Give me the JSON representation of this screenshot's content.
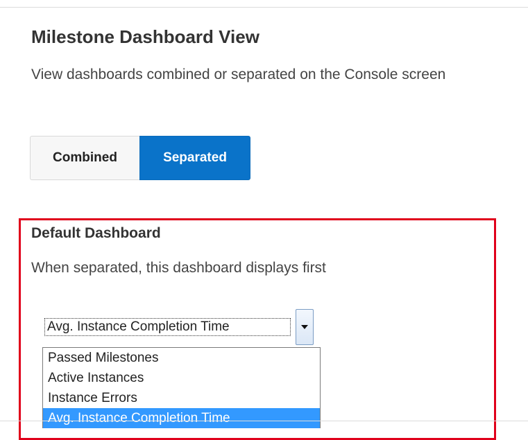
{
  "header": {
    "title": "Milestone Dashboard View",
    "description": "View dashboards combined or separated on the Console screen"
  },
  "view_toggle": {
    "options": [
      "Combined",
      "Separated"
    ],
    "selected": "Separated",
    "colors": {
      "active_bg": "#0a73c9",
      "inactive_bg": "#f7f7f7"
    }
  },
  "default_dashboard": {
    "title": "Default Dashboard",
    "description": "When separated, this dashboard displays first",
    "highlight_color": "#e0001b",
    "select": {
      "value": "Avg. Instance Completion Time",
      "arrow_icon": "triangle-down",
      "options": [
        "Passed Milestones",
        "Active Instances",
        "Instance Errors",
        "Avg. Instance Completion Time"
      ],
      "selected_option": "Avg. Instance Completion Time",
      "selected_color": "#3399ff"
    }
  }
}
